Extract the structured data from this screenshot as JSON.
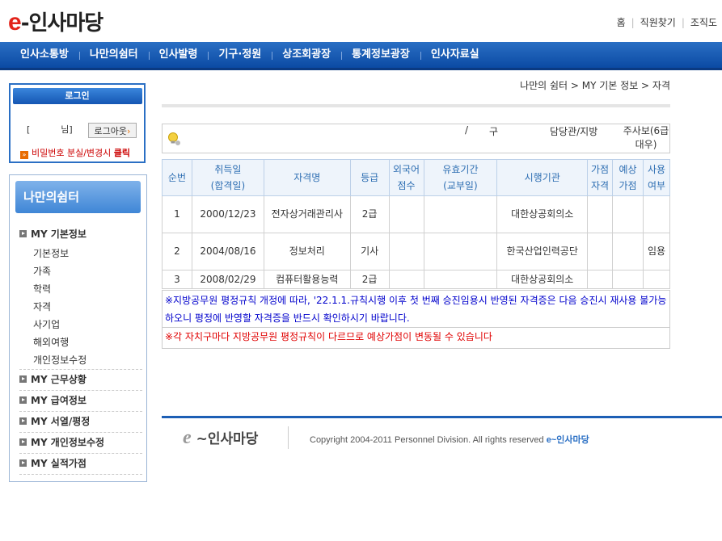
{
  "header": {
    "logo_e": "e",
    "logo_text": "-인사마당",
    "top_links": [
      "홈",
      "직원찾기",
      "조직도"
    ]
  },
  "nav": {
    "items": [
      "인사소통방",
      "나만의쉼터",
      "인사발령",
      "기구·정원",
      "상조회광장",
      "통계정보광장",
      "인사자료실"
    ]
  },
  "login": {
    "title": "로그인",
    "bracket": "[",
    "nim": "님]",
    "logout_label": "로그아웃",
    "logout_arrow": "›",
    "pw_text": "비밀번호 분실/변경시",
    "pw_click": "클릭",
    "pw_bullet": "»"
  },
  "sidebar": {
    "title": "나만의쉼터",
    "groups": [
      {
        "label": "MY 기본정보",
        "items": [
          "기본정보",
          "가족",
          "학력",
          "자격",
          "사기업",
          "해외여행",
          "개인정보수정"
        ]
      },
      {
        "label": "MY 근무상황"
      },
      {
        "label": "MY 급여정보"
      },
      {
        "label": "MY 서열/평정"
      },
      {
        "label": "MY 개인정보수정"
      },
      {
        "label": "MY 실적가점"
      }
    ]
  },
  "breadcrumb": "나만의 쉼터 > MY 기본 정보 > 자격",
  "info": {
    "slash": "/",
    "gu": "구",
    "dept": "담당관/지방",
    "rank": "주사보(6급대우)"
  },
  "table": {
    "headers": [
      "순번",
      "취득일\n(합격일)",
      "자격명",
      "등급",
      "외국어\n점수",
      "유효기간\n(교부일)",
      "시행기관",
      "가점\n자격",
      "예상\n가점",
      "사용\n여부"
    ],
    "rows": [
      [
        "1",
        "2000/12/23",
        "전자상거래관리사",
        "2급",
        "",
        "",
        "대한상공회의소",
        "",
        "",
        ""
      ],
      [
        "2",
        "2004/08/16",
        "정보처리",
        "기사",
        "",
        "",
        "한국산업인력공단",
        "",
        "",
        "임용"
      ],
      [
        "3",
        "2008/02/29",
        "컴퓨터활용능력",
        "2급",
        "",
        "",
        "대한상공회의소",
        "",
        "",
        ""
      ]
    ]
  },
  "notes": {
    "blue": "※지방공무원 평정규칙 개정에 따라, '22.1.1.규칙시행 이후 첫 번째 승진임용시 반영된 자격증은 다음 승진시 재사용 불가능하오니 평정에 반영할 자격증을 반드시 확인하시기 바랍니다.",
    "red": "※각 자치구마다 지방공무원 평정규칙이 다르므로 예상가점이 변동될 수 있습니다"
  },
  "footer": {
    "logo_e": "e",
    "logo_text": "~인사마당",
    "copyright": "Copyright 2004-2011 Personnel Division. All rights reserved",
    "brand": "e~인사마당"
  },
  "colors": {
    "nav_blue": "#0b4aa3",
    "logo_red": "#e2231a",
    "note_blue": "#0000cc",
    "note_red": "#e00000"
  }
}
